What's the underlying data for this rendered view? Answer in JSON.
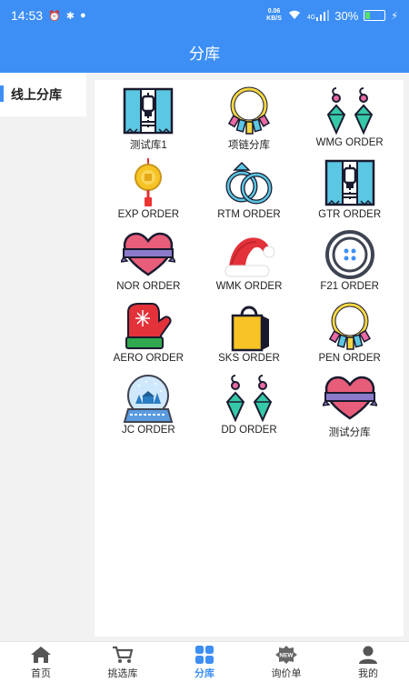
{
  "status_bar": {
    "time": "14:53",
    "net_speed_value": "0.06",
    "net_speed_unit": "KB/S",
    "network": "4G",
    "battery_percent": "30%",
    "battery_level": 0.3
  },
  "header": {
    "title": "分库"
  },
  "sidebar": {
    "items": [
      {
        "label": "线上分库",
        "active": true
      }
    ]
  },
  "grid": {
    "items": [
      {
        "label": "测试库1",
        "icon": "zipper-icon"
      },
      {
        "label": "项链分库",
        "icon": "necklace-icon"
      },
      {
        "label": "WMG ORDER",
        "icon": "earrings-icon"
      },
      {
        "label": "EXP ORDER",
        "icon": "gold-coin-pendant-icon"
      },
      {
        "label": "RTM ORDER",
        "icon": "rings-icon"
      },
      {
        "label": "GTR ORDER",
        "icon": "zipper-icon"
      },
      {
        "label": "NOR ORDER",
        "icon": "heart-ribbon-icon"
      },
      {
        "label": "WMK ORDER",
        "icon": "santa-hat-icon"
      },
      {
        "label": "F21 ORDER",
        "icon": "button-icon"
      },
      {
        "label": "AERO ORDER",
        "icon": "mitten-icon"
      },
      {
        "label": "SKS ORDER",
        "icon": "shopping-bag-icon"
      },
      {
        "label": "PEN ORDER",
        "icon": "necklace-icon"
      },
      {
        "label": "JC ORDER",
        "icon": "snow-globe-icon"
      },
      {
        "label": "DD ORDER",
        "icon": "earrings-icon"
      },
      {
        "label": "测试分库",
        "icon": "heart-ribbon-icon"
      }
    ]
  },
  "bottom_nav": {
    "items": [
      {
        "label": "首页",
        "icon": "home-icon"
      },
      {
        "label": "挑选库",
        "icon": "cart-icon"
      },
      {
        "label": "分库",
        "icon": "grid-icon",
        "active": true
      },
      {
        "label": "询价单",
        "icon": "new-badge-icon"
      },
      {
        "label": "我的",
        "icon": "user-icon"
      }
    ]
  },
  "colors": {
    "primary": "#3d8ff5",
    "background": "#f2f2f2"
  }
}
